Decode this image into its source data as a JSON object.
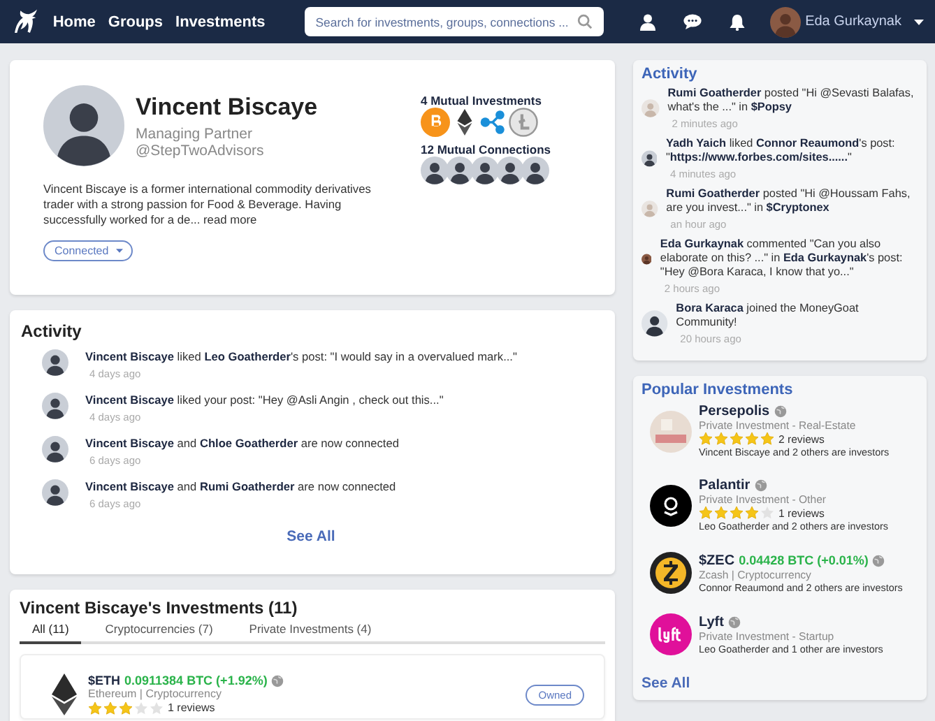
{
  "nav": {
    "links": [
      "Home",
      "Groups",
      "Investments"
    ],
    "search": {
      "placeholder": "Search for investments, groups, connections ..."
    },
    "user": "Eda Gurkaynak"
  },
  "profile": {
    "name": "Vincent Biscaye",
    "role": "Managing Partner",
    "company": "@StepTwoAdvisors",
    "bio": "Vincent Biscaye is a former international commodity derivatives trader with a strong passion for Food & Beverage. Having successfully worked for a de...",
    "read_more": "read more",
    "connection": "Connected",
    "mutual_investments": {
      "title": "4 Mutual Investments",
      "coins": [
        {
          "kind": "bitcoin"
        },
        {
          "kind": "ethereum"
        },
        {
          "kind": "ripple"
        },
        {
          "kind": "litecoin"
        }
      ]
    },
    "mutual_connections": {
      "title": "12 Mutual Connections",
      "avatars": [
        {
          "kind": "photo"
        },
        {
          "kind": "photo"
        },
        {
          "kind": "photo"
        },
        {
          "kind": "photo"
        },
        {
          "kind": "photo"
        }
      ]
    }
  },
  "activity": {
    "title": "Activity",
    "items": [
      {
        "text": "**Vincent Biscaye** liked **Leo Goatherder**'s post: \"I would say in a overvalued mark...\"",
        "time": "4 days ago"
      },
      {
        "text": "**Vincent Biscaye** liked your post: \"Hey @Asli Angin , check out this...\"",
        "time": "4 days ago"
      },
      {
        "text": "**Vincent Biscaye** and **Chloe Goatherder** are now connected",
        "time": "6 days ago"
      },
      {
        "text": "**Vincent Biscaye** and **Rumi Goatherder** are now connected",
        "time": "6 days ago"
      }
    ],
    "see_all": "See All"
  },
  "investments": {
    "title": "Vincent Biscaye's Investments (11)",
    "tabs": [
      {
        "label": "All (11)",
        "selected": true
      },
      {
        "label": "Cryptocurrencies (7)",
        "selected": false
      },
      {
        "label": "Private Investments (4)",
        "selected": false
      }
    ],
    "items": [
      {
        "ticker": "$ETH",
        "price": "0.0911384 BTC (+1.92%)",
        "subtitle": "Ethereum | Cryptocurrency",
        "stars": 3,
        "reviews": "1 reviews",
        "badge": "Owned"
      }
    ]
  },
  "side_activity": {
    "title": "Activity",
    "items": [
      {
        "text": "**Rumi Goatherder** posted \"Hi @Sevasti Balafas, what's the ...\" in **$Popsy**",
        "time": "2 minutes ago"
      },
      {
        "text": "**Yadh Yaich** liked **Connor Reaumond**'s post: \"**https://www.forbes.com/sites......**\"",
        "time": "4 minutes ago"
      },
      {
        "text": "**Rumi Goatherder** posted \"Hi @Houssam Fahs, are you invest...\" in **$Cryptonex**",
        "time": "an hour ago"
      },
      {
        "text": "**Eda Gurkaynak** commented \"Can you also elaborate on this? ...\" in **Eda Gurkaynak**'s post: \"Hey @Bora Karaca, I know that yo...\"",
        "time": "2 hours ago"
      },
      {
        "text": "**Bora Karaca** joined the MoneyGoat Community!",
        "time": "20 hours ago"
      }
    ]
  },
  "popular": {
    "title": "Popular Investments",
    "items": [
      {
        "kind": "photo",
        "name": "Persepolis",
        "subtitle": "Private Investment - Real-Estate",
        "stars": 5,
        "reviews": "2 reviews",
        "investors": "Vincent Biscaye and 2 others are investors"
      },
      {
        "kind": "palantir",
        "name": "Palantir",
        "subtitle": "Private Investment - Other",
        "stars": 4,
        "reviews": "1 reviews",
        "investors": "Leo Goatherder and 2 others are investors"
      },
      {
        "kind": "zcash",
        "name": "$ZEC",
        "price": "0.04428 BTC (+0.01%)",
        "subtitle": "Zcash | Cryptocurrency",
        "investors": "Connor Reaumond and 2 others are investors"
      },
      {
        "kind": "lyft",
        "name": "Lyft",
        "subtitle": "Private Investment - Startup",
        "investors": "Leo Goatherder and 1 other are investors"
      }
    ],
    "see_all": "See All"
  }
}
